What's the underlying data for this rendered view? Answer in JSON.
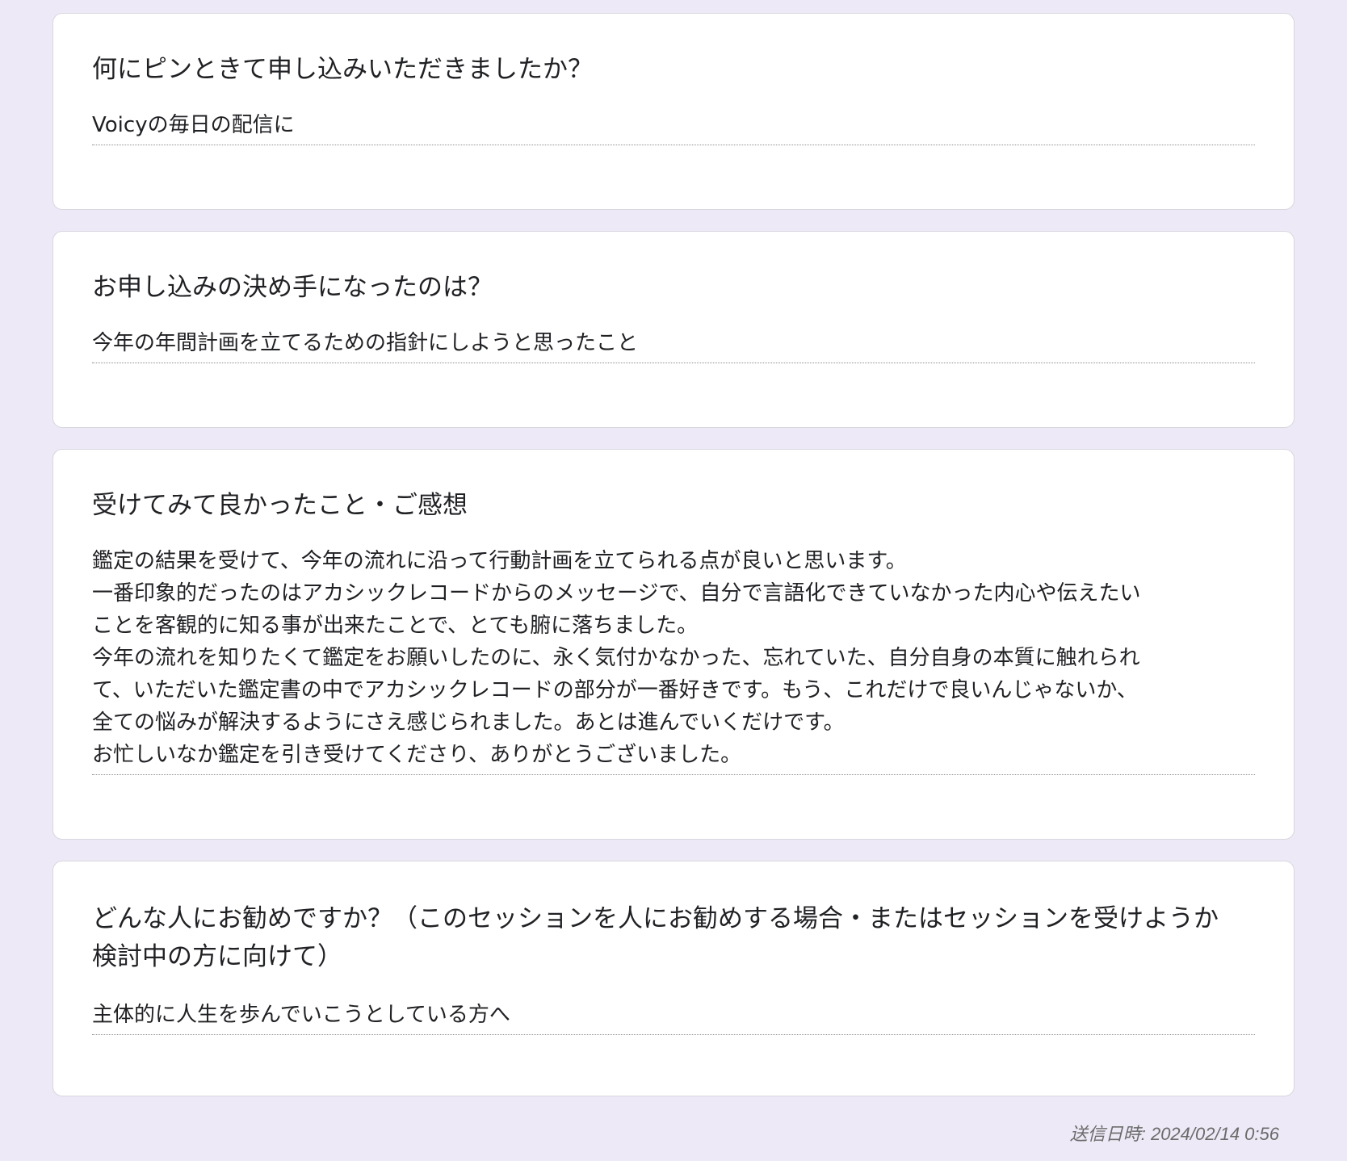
{
  "questions": [
    {
      "question": "何にピンときて申し込みいただきましたか？",
      "answer": "Voicyの毎日の配信に"
    },
    {
      "question": "お申し込みの決め手になったのは？",
      "answer": "今年の年間計画を立てるための指針にしようと思ったこと"
    },
    {
      "question": "受けてみて良かったこと・ご感想",
      "answer": "鑑定の結果を受けて、今年の流れに沿って行動計画を立てられる点が良いと思います。\n一番印象的だったのはアカシックレコードからのメッセージで、自分で言語化できていなかった内心や伝えたい\nことを客観的に知る事が出来たことで、とても腑に落ちました。\n今年の流れを知りたくて鑑定をお願いしたのに、永く気付かなかった、忘れていた、自分自身の本質に触れられ\nて、いただいた鑑定書の中でアカシックレコードの部分が一番好きです。もう、これだけで良いんじゃないか、\n全ての悩みが解決するようにさえ感じられました。あとは進んでいくだけです。\nお忙しいなか鑑定を引き受けてくださり、ありがとうございました。"
    },
    {
      "question": "どんな人にお勧めですか？（このセッションを人にお勧めする場合・またはセッションを受けようか\n検討中の方に向けて）",
      "answer": "主体的に人生を歩んでいこうとしている方へ"
    }
  ],
  "footer": {
    "timestamp": "送信日時: 2024/02/14 0:56"
  },
  "colors": {
    "background": "#ede9f6",
    "card": "#ffffff",
    "text": "#202124",
    "muted": "#6b6b6b"
  }
}
